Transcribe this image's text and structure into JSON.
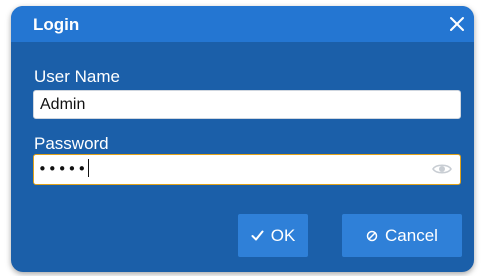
{
  "dialog": {
    "title": "Login",
    "close_icon": "close-icon"
  },
  "fields": {
    "username": {
      "label": "User Name",
      "value": "Admin"
    },
    "password": {
      "label": "Password",
      "masked_value": "•••••",
      "reveal_icon": "eye-icon"
    }
  },
  "buttons": {
    "ok": {
      "label": "OK",
      "icon": "check-icon"
    },
    "cancel": {
      "label": "Cancel",
      "icon": "cancel-icon"
    }
  },
  "colors": {
    "dialog_bg": "#1b5fa9",
    "titlebar_bg": "#2476d2",
    "button_bg": "#2f80d8",
    "focus_border": "#e0a21a"
  }
}
